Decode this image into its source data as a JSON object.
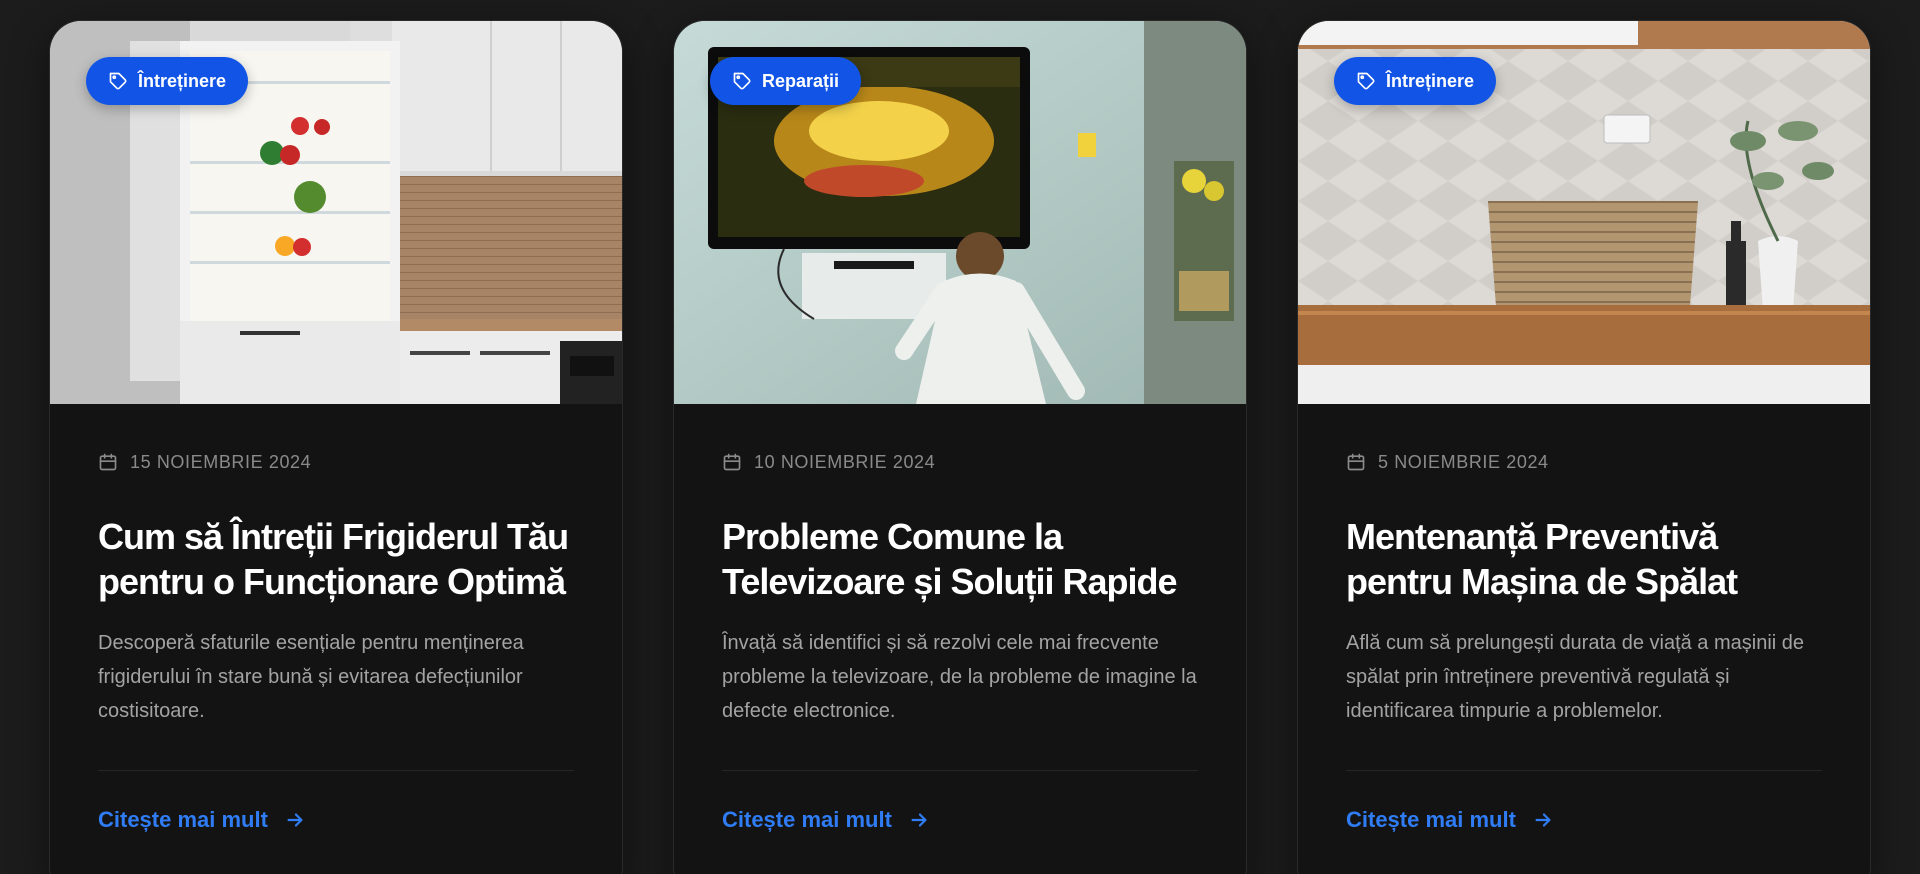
{
  "colors": {
    "page_bg": "#1c1c1c",
    "card_bg": "#131313",
    "tag_bg": "#1255e6",
    "link": "#2f7cf5",
    "date_text": "#8a8a8a",
    "excerpt_text": "#a3a3a3"
  },
  "cards": [
    {
      "image": "kitchen-open-fridge-photo",
      "tag": "Întreținere",
      "date": "15 NOIEMBRIE 2024",
      "title": "Cum să Întreții Frigiderul Tău pentru o Funcționare Optimă",
      "excerpt": "Descoperă sfaturile esențiale pentru menținerea frigiderului în stare bună și evitarea defecțiunilor costisitoare.",
      "cta": "Citește mai mult"
    },
    {
      "image": "child-watching-tv-photo",
      "tag": "Reparații",
      "date": "10 NOIEMBRIE 2024",
      "title": "Probleme Comune la Televizoare și Soluții Rapide",
      "excerpt": "Învață să identifici și să rezolvi cele mai frecvente probleme la televizoare, de la probleme de imagine la defecte electronice.",
      "cta": "Citește mai mult"
    },
    {
      "image": "kitchen-counter-basket-photo",
      "tag": "Întreținere",
      "date": "5 NOIEMBRIE 2024",
      "title": "Mentenanță Preventivă pentru Mașina de Spălat",
      "excerpt": "Află cum să prelungești durata de viață a mașinii de spălat prin întreținere preventivă regulată și identificarea timpurie a problemelor.",
      "cta": "Citește mai mult"
    }
  ]
}
